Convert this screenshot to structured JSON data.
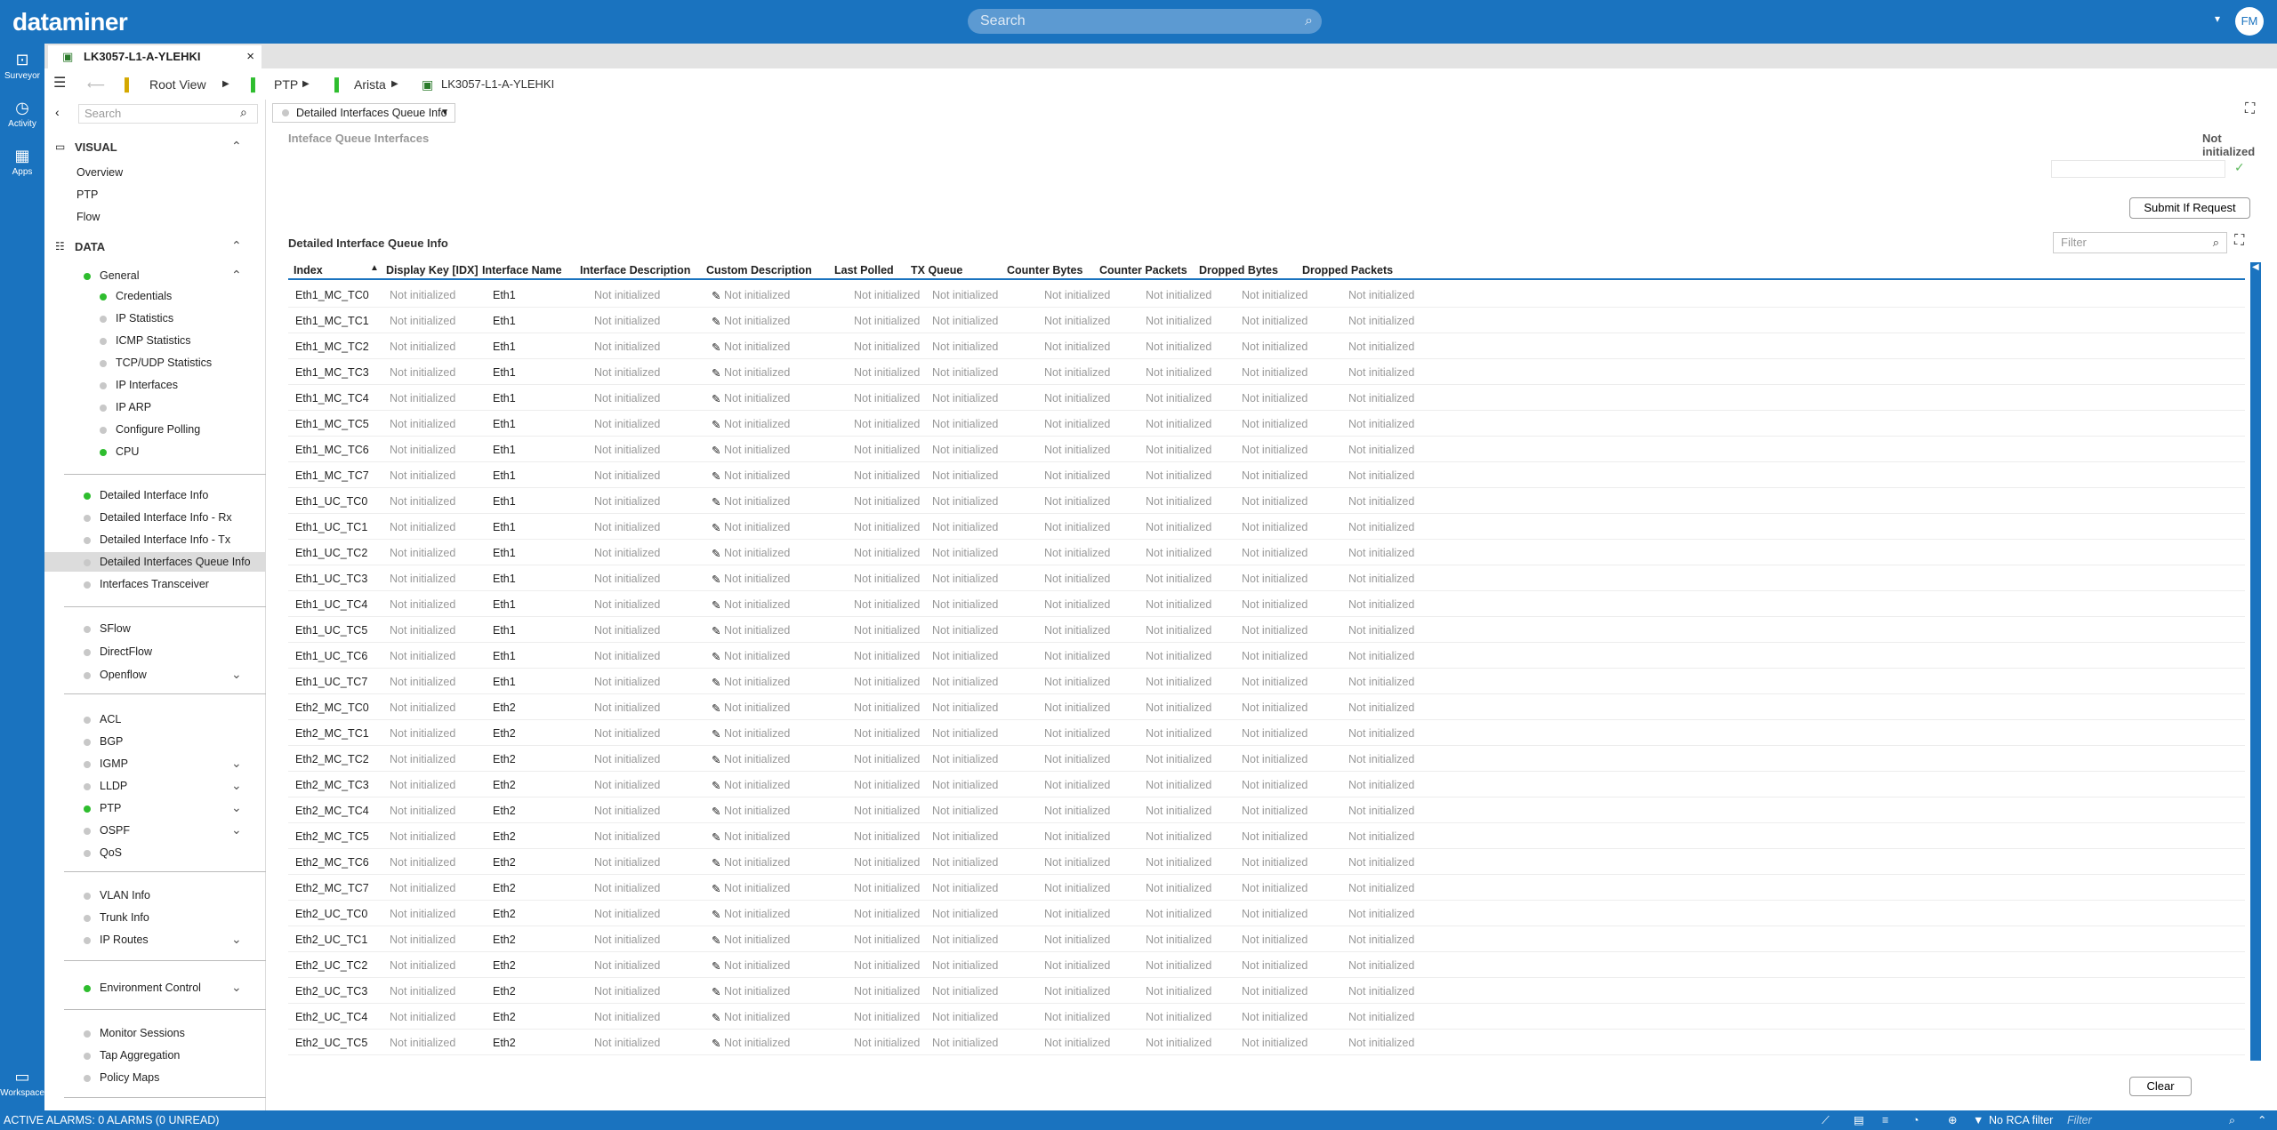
{
  "app": {
    "logo": "dataminer",
    "search_placeholder": "Search",
    "avatar": "FM"
  },
  "left_nav": {
    "surveyor": "Surveyor",
    "activity": "Activity",
    "apps": "Apps",
    "workspace": "Workspace"
  },
  "card_tab": {
    "title": "LK3057-L1-A-YLEHKI"
  },
  "breadcrumb": {
    "root": "Root View",
    "c1": "PTP",
    "c2": "Arista",
    "c3": "LK3057-L1-A-YLEHKI"
  },
  "sidebar": {
    "search_placeholder": "Search",
    "visual_head": "VISUAL",
    "visual_items": [
      "Overview",
      "PTP",
      "Flow"
    ],
    "data_head": "DATA",
    "general": "General",
    "general_items": [
      "Credentials",
      "IP Statistics",
      "ICMP Statistics",
      "TCP/UDP Statistics",
      "IP Interfaces",
      "IP ARP",
      "Configure Polling",
      "CPU"
    ],
    "g2": [
      "Detailed Interface Info",
      "Detailed Interface Info - Rx",
      "Detailed Interface Info - Tx",
      "Detailed Interfaces Queue Info",
      "Interfaces Transceiver"
    ],
    "g3": [
      "SFlow",
      "DirectFlow",
      "Openflow"
    ],
    "g4": [
      "ACL",
      "BGP",
      "IGMP",
      "LLDP",
      "PTP",
      "OSPF",
      "QoS"
    ],
    "g5": [
      "VLAN Info",
      "Trunk Info",
      "IP Routes"
    ],
    "g6": [
      "Environment Control"
    ],
    "g7": [
      "Monitor Sessions",
      "Tap Aggregation",
      "Policy Maps"
    ]
  },
  "page": {
    "selector": "Detailed Interfaces Queue Info",
    "section_label": "Inteface Queue Interfaces",
    "status": "Not initialized",
    "submit": "Submit If Request",
    "table_title": "Detailed Interface Queue Info",
    "filter_placeholder": "Filter",
    "clear": "Clear"
  },
  "table": {
    "columns": [
      "Index",
      "Display Key [IDX]",
      "Interface Name",
      "Interface Description",
      "Custom Description",
      "Last Polled",
      "TX Queue",
      "Counter Bytes",
      "Counter Packets",
      "Dropped Bytes",
      "Dropped Packets"
    ],
    "ni": "Not initialized",
    "rows": [
      [
        "Eth1_MC_TC0",
        "Eth1"
      ],
      [
        "Eth1_MC_TC1",
        "Eth1"
      ],
      [
        "Eth1_MC_TC2",
        "Eth1"
      ],
      [
        "Eth1_MC_TC3",
        "Eth1"
      ],
      [
        "Eth1_MC_TC4",
        "Eth1"
      ],
      [
        "Eth1_MC_TC5",
        "Eth1"
      ],
      [
        "Eth1_MC_TC6",
        "Eth1"
      ],
      [
        "Eth1_MC_TC7",
        "Eth1"
      ],
      [
        "Eth1_UC_TC0",
        "Eth1"
      ],
      [
        "Eth1_UC_TC1",
        "Eth1"
      ],
      [
        "Eth1_UC_TC2",
        "Eth1"
      ],
      [
        "Eth1_UC_TC3",
        "Eth1"
      ],
      [
        "Eth1_UC_TC4",
        "Eth1"
      ],
      [
        "Eth1_UC_TC5",
        "Eth1"
      ],
      [
        "Eth1_UC_TC6",
        "Eth1"
      ],
      [
        "Eth1_UC_TC7",
        "Eth1"
      ],
      [
        "Eth2_MC_TC0",
        "Eth2"
      ],
      [
        "Eth2_MC_TC1",
        "Eth2"
      ],
      [
        "Eth2_MC_TC2",
        "Eth2"
      ],
      [
        "Eth2_MC_TC3",
        "Eth2"
      ],
      [
        "Eth2_MC_TC4",
        "Eth2"
      ],
      [
        "Eth2_MC_TC5",
        "Eth2"
      ],
      [
        "Eth2_MC_TC6",
        "Eth2"
      ],
      [
        "Eth2_MC_TC7",
        "Eth2"
      ],
      [
        "Eth2_UC_TC0",
        "Eth2"
      ],
      [
        "Eth2_UC_TC1",
        "Eth2"
      ],
      [
        "Eth2_UC_TC2",
        "Eth2"
      ],
      [
        "Eth2_UC_TC3",
        "Eth2"
      ],
      [
        "Eth2_UC_TC4",
        "Eth2"
      ],
      [
        "Eth2_UC_TC5",
        "Eth2"
      ]
    ]
  },
  "statusbar": {
    "alarms": "ACTIVE ALARMS: 0 ALARMS (0 UNREAD)",
    "rca": "No RCA filter",
    "filter": "Filter"
  }
}
